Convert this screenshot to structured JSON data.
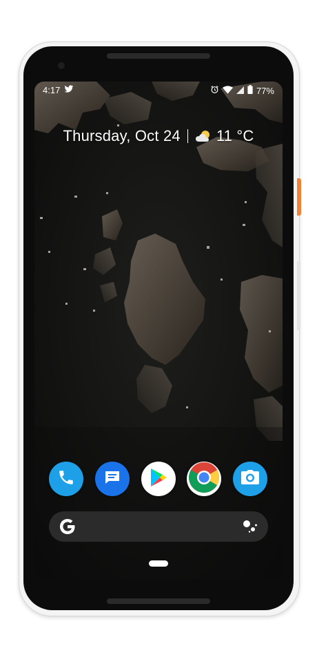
{
  "status_bar": {
    "time": "4:17",
    "notification_icons": [
      "twitter-icon"
    ],
    "system_icons": [
      "alarm-icon",
      "wifi-icon",
      "cell-signal-icon",
      "battery-icon"
    ],
    "battery": "77%"
  },
  "glance": {
    "date": "Thursday, Oct 24",
    "temperature": "11 °C",
    "weather_icon": "partly-cloudy-icon"
  },
  "dock": {
    "apps": [
      {
        "name": "Phone",
        "icon": "phone-icon",
        "color": "#1ea0e8"
      },
      {
        "name": "Messages",
        "icon": "messages-icon",
        "color": "#1a73e8"
      },
      {
        "name": "Play Store",
        "icon": "play-store-icon",
        "color": "#ffffff"
      },
      {
        "name": "Chrome",
        "icon": "chrome-icon",
        "color": "#ffffff"
      },
      {
        "name": "Camera",
        "icon": "camera-icon",
        "color": "#1ea0e8"
      }
    ]
  },
  "search_bar": {
    "logo": "google-g-icon",
    "assistant": "assistant-icon"
  },
  "colors": {
    "accent_side_button": "#f0833a",
    "search_bar_bg": "#2b2b2b"
  }
}
